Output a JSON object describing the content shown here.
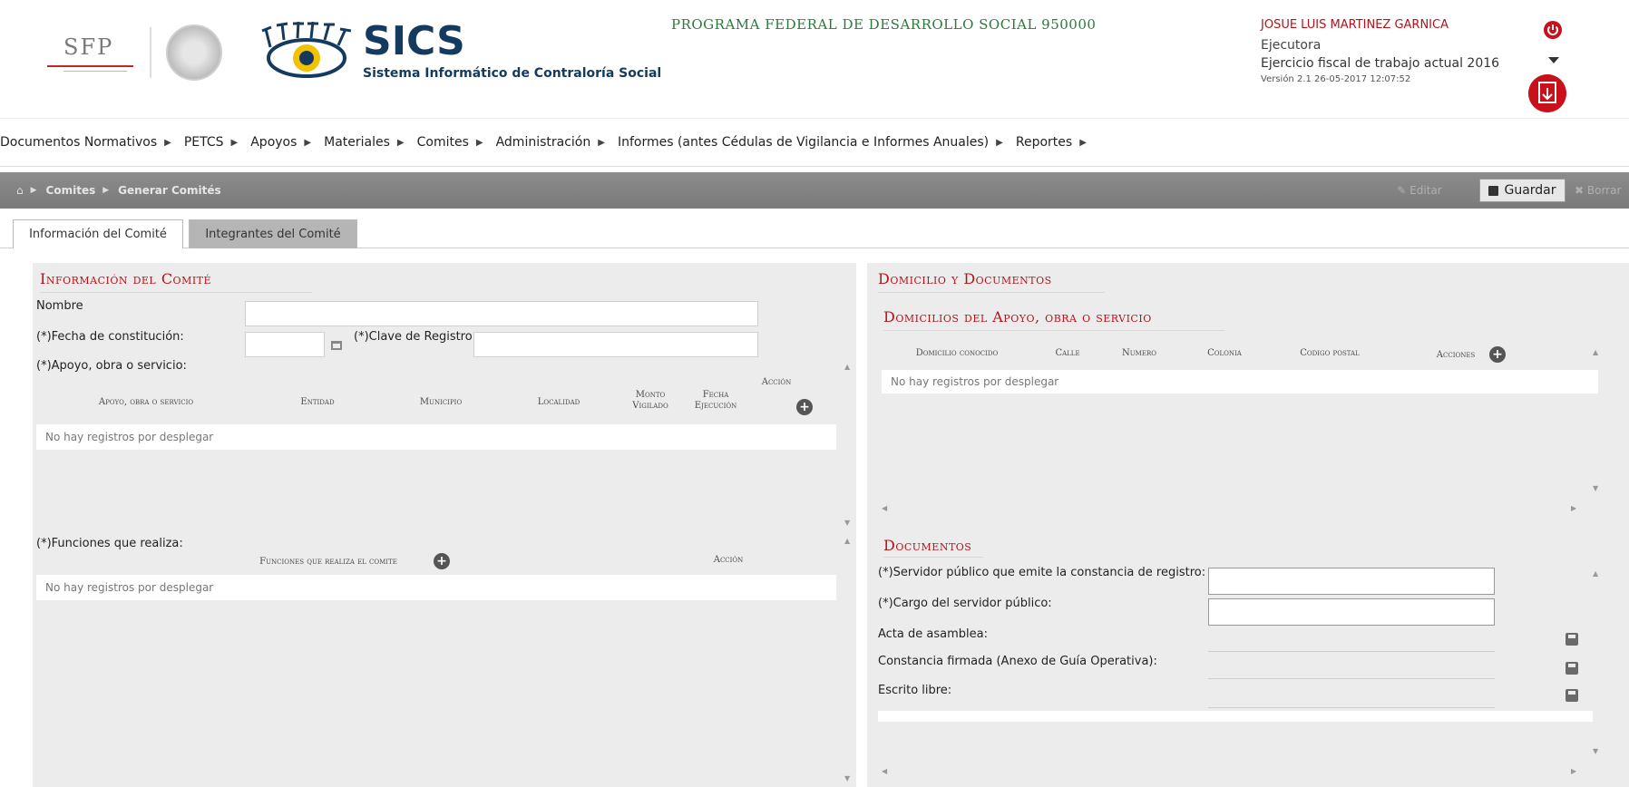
{
  "header": {
    "sfp_logo_text": "SFP",
    "app_name": "SICS",
    "app_subtitle": "Sistema Informático de Contraloría Social",
    "programa": "PROGRAMA FEDERAL DE DESARROLLO SOCIAL 950000",
    "user": {
      "name": "JOSUE LUIS MARTINEZ GARNICA",
      "role": "Ejecutora",
      "ejercicio": "Ejercicio fiscal de trabajo actual  2016",
      "version": "Versión 2.1    26-05-2017 12:07:52"
    },
    "colors": {
      "accent_red": "#b3141b",
      "brand_navy": "#143a5f",
      "programa_green": "#2b7a3b"
    }
  },
  "menu": {
    "items": [
      "Documentos Normativos",
      "PETCS",
      "Apoyos",
      "Materiales",
      "Comites",
      "Administración",
      "Informes (antes Cédulas de Vigilancia e Informes Anuales)",
      "Reportes"
    ]
  },
  "breadcrumb": {
    "items": [
      "Comites",
      "Generar Comités"
    ]
  },
  "toolbar": {
    "editar_label": "Editar",
    "guardar_label": "Guardar",
    "borrar_label": "Borrar"
  },
  "tabs": [
    "Información del Comité",
    "Integrantes del Comité"
  ],
  "info_comite": {
    "title": "Información del Comité",
    "nombre_label": "Nombre",
    "nombre_value": "",
    "fecha_label": "(*)Fecha de constitución:",
    "fecha_value": "",
    "clave_label": "(*)Clave de Registro:",
    "clave_value": "",
    "apoyo_label": "(*)Apoyo, obra o servicio:",
    "apoyo_grid": {
      "columns": [
        "Apoyo, obra o servicio",
        "Entidad",
        "Municipio",
        "Localidad",
        "Monto Vigilado",
        "Fecha Ejecución",
        "Acción"
      ],
      "empty_text": "No hay registros por desplegar"
    },
    "funciones_label": "(*)Funciones que realiza:",
    "funciones_grid": {
      "columns": [
        "Funciones que realiza el comite",
        "Acción"
      ],
      "empty_text": "No hay registros por desplegar"
    }
  },
  "domicilio": {
    "title": "Domicilio y Documentos",
    "domicilios_title": "Domicilios del Apoyo, obra o servicio",
    "grid": {
      "columns": [
        "Domicilio conocido",
        "Calle",
        "Numero",
        "Colonia",
        "Codigo postal",
        "Acciones"
      ],
      "empty_text": "No hay registros por desplegar"
    }
  },
  "documentos": {
    "title": "Documentos",
    "servidor_label": "(*)Servidor público que emite la constancia de registro:",
    "servidor_value": "",
    "cargo_label": "(*)Cargo del servidor público:",
    "cargo_value": "",
    "acta_label": "Acta de asamblea:",
    "constancia_label": "Constancia firmada (Anexo de Guía Operativa):",
    "escrito_label": "Escrito libre:"
  }
}
